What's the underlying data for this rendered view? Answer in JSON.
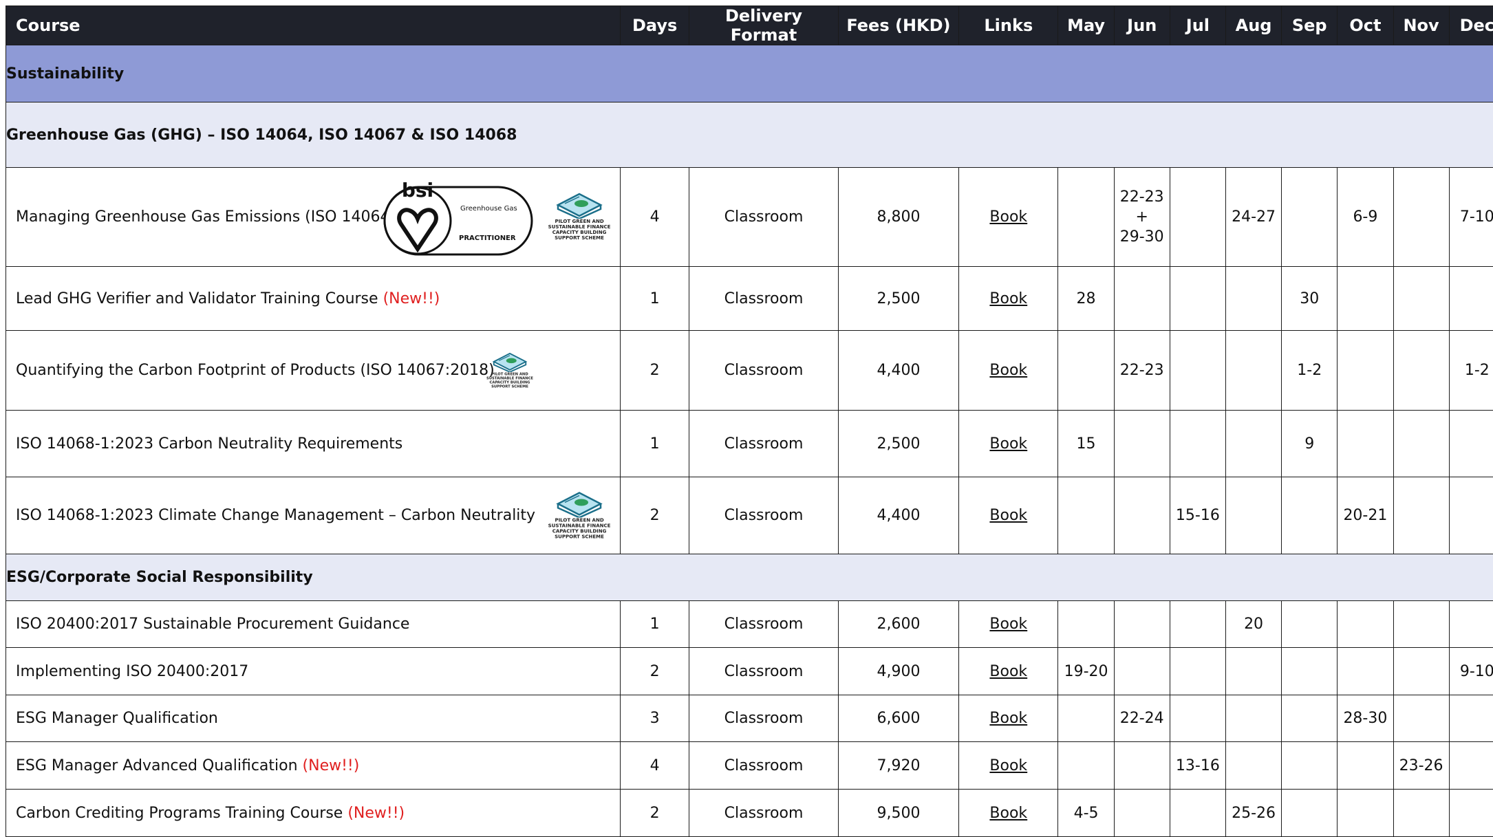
{
  "columns": [
    "Course",
    "Days",
    "Delivery Format",
    "Fees (HKD)",
    "Links",
    "May",
    "Jun",
    "Jul",
    "Aug",
    "Sep",
    "Oct",
    "Nov",
    "Dec"
  ],
  "sections": {
    "sustainability": "Sustainability",
    "ghg": "Greenhouse Gas (GHG) – ISO 14064, ISO 14067 & ISO 14068",
    "esg": "ESG/Corporate Social Responsibility"
  },
  "badges": {
    "new": "(New!!)",
    "bsi_brand": "bsi",
    "bsi_topic": "Greenhouse Gas",
    "bsi_level": "PRACTITIONER",
    "pilot_label": "PILOT GREEN AND SUSTAINABLE FINANCE CAPACITY BUILDING SUPPORT SCHEME"
  },
  "rows": [
    {
      "course": "Managing Greenhouse Gas Emissions (ISO 14064)",
      "days": "4",
      "format": "Classroom",
      "fees": "8,800",
      "link": "Book",
      "may": "",
      "jun": "22-23 + 29-30",
      "jul": "",
      "aug": "24-27",
      "sep": "",
      "oct": "6-9",
      "nov": "",
      "dec": "7-10"
    },
    {
      "course": "Lead GHG Verifier and Validator Training Course",
      "days": "1",
      "format": "Classroom",
      "fees": "2,500",
      "link": "Book",
      "may": "28",
      "jun": "",
      "jul": "",
      "aug": "",
      "sep": "30",
      "oct": "",
      "nov": "",
      "dec": ""
    },
    {
      "course": "Quantifying the Carbon Footprint of Products (ISO 14067:2018)",
      "days": "2",
      "format": "Classroom",
      "fees": "4,400",
      "link": "Book",
      "may": "",
      "jun": "22-23",
      "jul": "",
      "aug": "",
      "sep": "1-2",
      "oct": "",
      "nov": "",
      "dec": "1-2"
    },
    {
      "course": "ISO 14068-1:2023 Carbon Neutrality Requirements",
      "days": "1",
      "format": "Classroom",
      "fees": "2,500",
      "link": "Book",
      "may": "15",
      "jun": "",
      "jul": "",
      "aug": "",
      "sep": "9",
      "oct": "",
      "nov": "",
      "dec": ""
    },
    {
      "course": "ISO 14068-1:2023 Climate Change Management – Carbon Neutrality",
      "days": "2",
      "format": "Classroom",
      "fees": "4,400",
      "link": "Book",
      "may": "",
      "jun": "",
      "jul": "15-16",
      "aug": "",
      "sep": "",
      "oct": "20-21",
      "nov": "",
      "dec": ""
    },
    {
      "course": "ISO 20400:2017 Sustainable Procurement Guidance",
      "days": "1",
      "format": "Classroom",
      "fees": "2,600",
      "link": "Book",
      "may": "",
      "jun": "",
      "jul": "",
      "aug": "20",
      "sep": "",
      "oct": "",
      "nov": "",
      "dec": ""
    },
    {
      "course": "Implementing ISO 20400:2017",
      "days": "2",
      "format": "Classroom",
      "fees": "4,900",
      "link": "Book",
      "may": "19-20",
      "jun": "",
      "jul": "",
      "aug": "",
      "sep": "",
      "oct": "",
      "nov": "",
      "dec": "9-10"
    },
    {
      "course": "ESG Manager Qualification",
      "days": "3",
      "format": "Classroom",
      "fees": "6,600",
      "link": "Book",
      "may": "",
      "jun": "22-24",
      "jul": "",
      "aug": "",
      "sep": "",
      "oct": "28-30",
      "nov": "",
      "dec": ""
    },
    {
      "course": "ESG Manager Advanced Qualification",
      "days": "4",
      "format": "Classroom",
      "fees": "7,920",
      "link": "Book",
      "may": "",
      "jun": "",
      "jul": "13-16",
      "aug": "",
      "sep": "",
      "oct": "",
      "nov": "23-26",
      "dec": ""
    },
    {
      "course": "Carbon Crediting Programs Training Course",
      "days": "2",
      "format": "Classroom",
      "fees": "9,500",
      "link": "Book",
      "may": "4-5",
      "jun": "",
      "jul": "",
      "aug": "25-26",
      "sep": "",
      "oct": "",
      "nov": "",
      "dec": ""
    }
  ]
}
